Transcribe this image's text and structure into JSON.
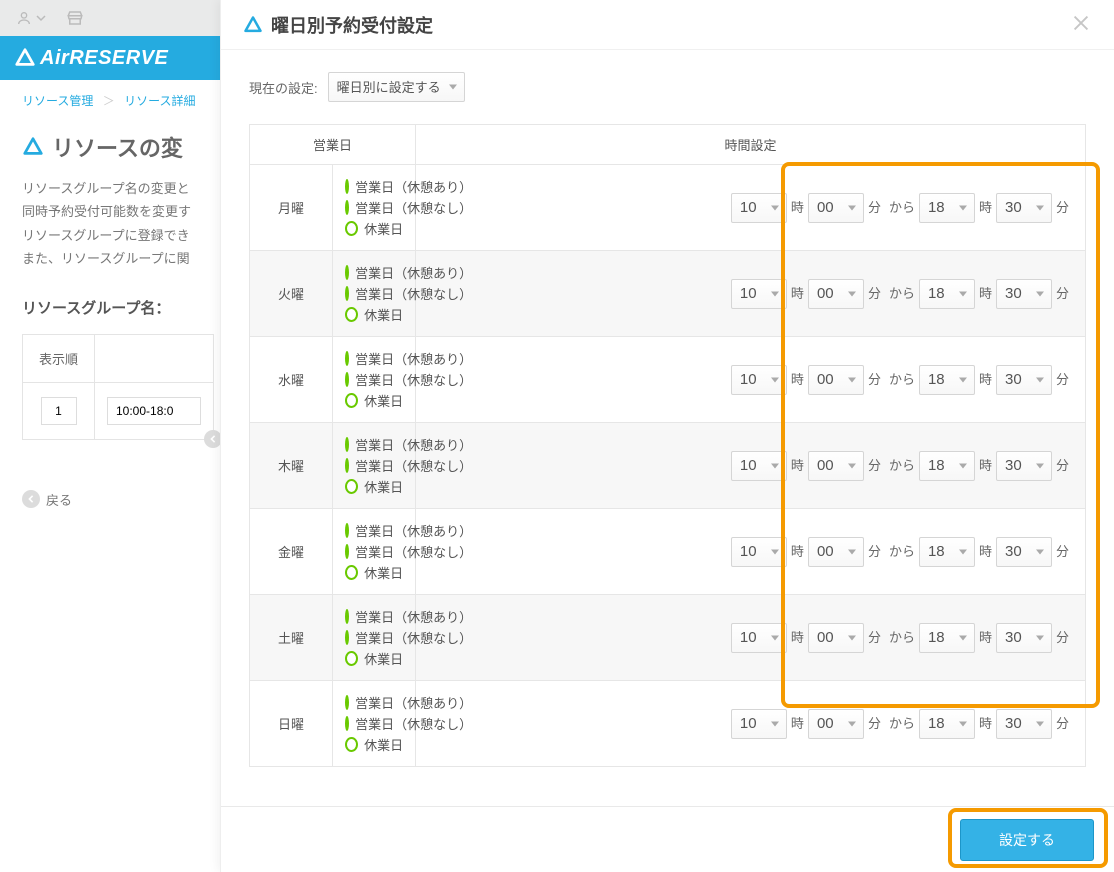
{
  "brand": {
    "name": "AirRESERVE"
  },
  "breadcrumbs": [
    "リソース管理",
    "リソース詳細"
  ],
  "page": {
    "title": "リソースの変",
    "desc_lines": [
      "リソースグループ名の変更と",
      "同時予約受付可能数を変更す",
      "リソースグループに登録でき",
      "また、リソースグループに関"
    ],
    "group_label": "リソースグループ名：",
    "table": {
      "header_order": "表示順",
      "row_order": "1",
      "row_time": "10:00-18:0"
    },
    "back": "戻る"
  },
  "dialog": {
    "title": "曜日別予約受付設定",
    "current_label": "現在の設定:",
    "current_option": "曜日別に設定する",
    "th_day": "営業日",
    "th_time": "時間設定",
    "radio_options": [
      "営業日（休憩あり）",
      "営業日（休憩なし）",
      "休業日"
    ],
    "selected_radio_index": 1,
    "labels": {
      "hour": "時",
      "minute": "分",
      "from": "から",
      "end_min": "分"
    },
    "days": [
      {
        "name": "月曜",
        "from_h": "10",
        "from_m": "00",
        "to_h": "18",
        "to_m": "30"
      },
      {
        "name": "火曜",
        "from_h": "10",
        "from_m": "00",
        "to_h": "18",
        "to_m": "30"
      },
      {
        "name": "水曜",
        "from_h": "10",
        "from_m": "00",
        "to_h": "18",
        "to_m": "30"
      },
      {
        "name": "木曜",
        "from_h": "10",
        "from_m": "00",
        "to_h": "18",
        "to_m": "30"
      },
      {
        "name": "金曜",
        "from_h": "10",
        "from_m": "00",
        "to_h": "18",
        "to_m": "30"
      },
      {
        "name": "土曜",
        "from_h": "10",
        "from_m": "00",
        "to_h": "18",
        "to_m": "30"
      },
      {
        "name": "日曜",
        "from_h": "10",
        "from_m": "00",
        "to_h": "18",
        "to_m": "30"
      }
    ],
    "apply": "設定する"
  }
}
